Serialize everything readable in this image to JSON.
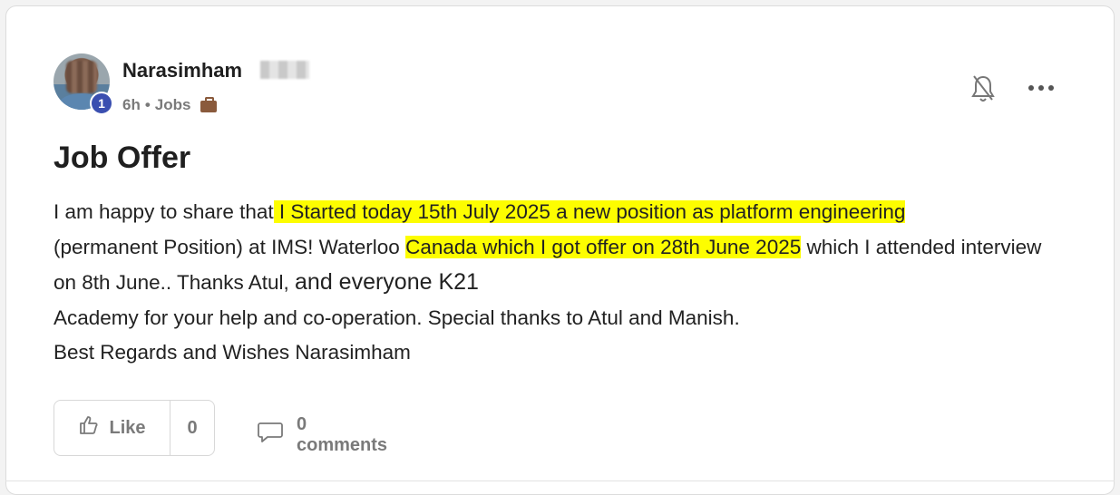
{
  "post": {
    "author": "Narasimham",
    "badge_count": "1",
    "time": "6h",
    "separator": "•",
    "category": "Jobs",
    "title": "Job Offer",
    "body": {
      "p1": "I am happy to share that",
      "h1": " I Started today 15th July 2025 a new position as platform engineering ",
      "p2": "(permanent Position) at IMS! Waterloo ",
      "h2": "Canada which I got offer on 28th June 2025",
      "p3": " which I attended interview on 8th June.. Thanks Atul, ",
      "p4": "and everyone K21",
      "p5": "Academy for your help and co-operation. Special thanks to Atul and Manish.",
      "p6": "Best Regards and Wishes Narasimham"
    },
    "highlight_color": "#fdfd00"
  },
  "actions": {
    "like_label": "Like",
    "like_count": "0",
    "comments_label": "0 comments"
  },
  "icons": {
    "bell": "bell-off-icon",
    "more": "more-horizontal-icon",
    "thumb": "thumbs-up-icon",
    "comment": "comment-bubble-icon",
    "briefcase": "briefcase-icon"
  }
}
